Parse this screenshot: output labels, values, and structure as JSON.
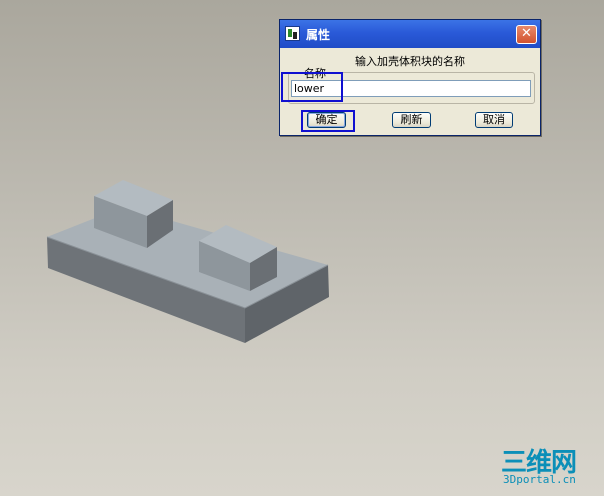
{
  "dialog": {
    "title": "属性",
    "prompt": "输入加壳体积块的名称",
    "group_label": "名称",
    "name_value": "lower",
    "buttons": {
      "ok": "确定",
      "refresh": "刷新",
      "cancel": "取消"
    },
    "close_glyph": "✕"
  },
  "watermark": {
    "brand": "三维网",
    "site": "3Dportal.cn"
  },
  "icons": {
    "app": "properties-app-icon",
    "close": "close-icon"
  },
  "colors": {
    "titlebar": "#2a5ad8",
    "highlight": "#1010d0",
    "model_face_light": "#a8b0b6",
    "model_face_dark": "#5e6368",
    "watermark": "#0b8fb8"
  }
}
